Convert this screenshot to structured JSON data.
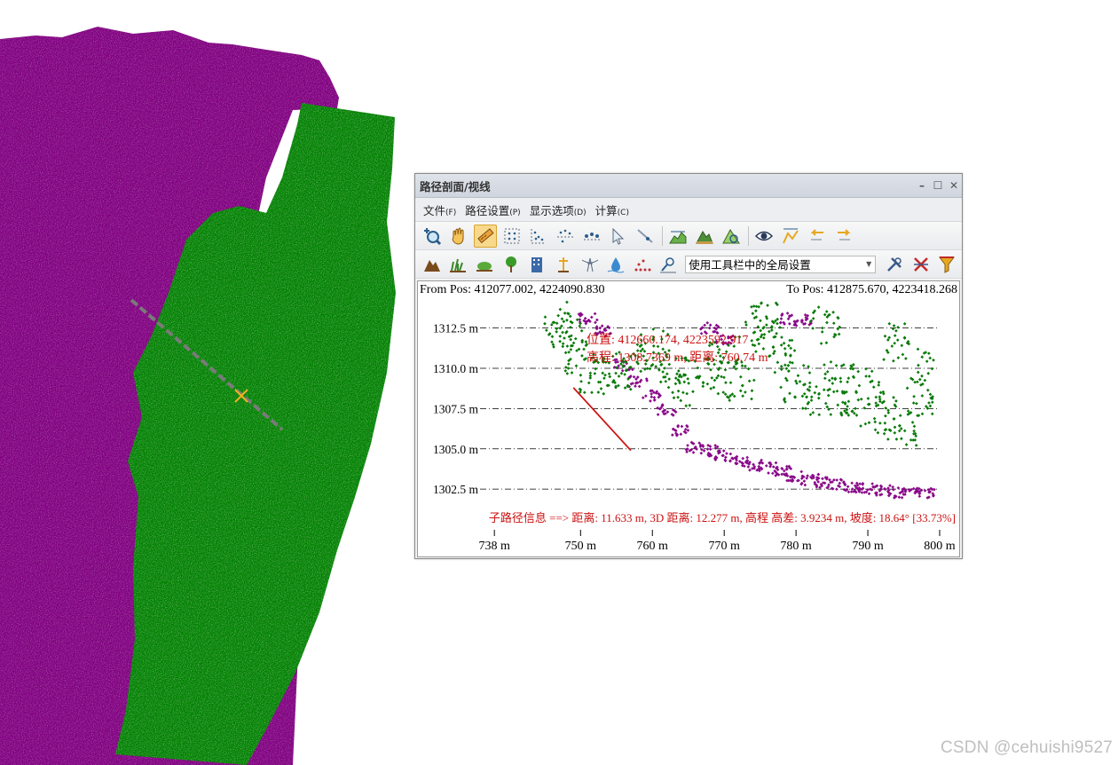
{
  "watermark": "CSDN @cehuishi9527",
  "window": {
    "title": "路径剖面/视线",
    "controls": {
      "minimize": "–",
      "maximize": "☐",
      "close": "✕"
    }
  },
  "menu": [
    {
      "label": "文件",
      "accel": "(F)"
    },
    {
      "label": "路径设置",
      "accel": "(P)"
    },
    {
      "label": "显示选项",
      "accel": "(D)"
    },
    {
      "label": "计算",
      "accel": "(C)"
    }
  ],
  "toolbar1_icons": [
    "zoom-in-icon",
    "pan-hand-icon",
    "measure-ruler-icon",
    "grid-points-icon",
    "scatter-points-icon",
    "point-line-icon",
    "profile-points-icon",
    "select-arrow-icon",
    "line-select-icon",
    "terrain-profile-icon",
    "mountain-profile-icon",
    "area-profile-icon",
    "visibility-eye-icon",
    "line-of-sight-icon",
    "step-back-icon",
    "step-forward-icon"
  ],
  "toolbar2_icons": [
    "ground-icon",
    "vegetation-low-icon",
    "shrub-icon",
    "tree-icon",
    "building-icon",
    "pole-icon",
    "powerline-icon",
    "water-icon",
    "dotted-line-icon",
    "pen-select-icon"
  ],
  "toolbar2_tail_icons": [
    "settings-tools-icon",
    "clear-icon",
    "filter-icon"
  ],
  "toolbar_combo": {
    "value": "使用工具栏中的全局设置",
    "arrow_icon": "chevron-down-icon"
  },
  "profile": {
    "from_label": "From Pos: 412077.002, 4224090.830",
    "to_label": "To Pos: 412875.670, 4223418.268",
    "cursor_info_1": "位置: 412660.174, 4223592.917",
    "cursor_info_2": "高程: 1308.7369 m, 距离: 760.74 m",
    "subpath_info": "子路径信息 ==> 距离: 11.633 m, 3D 距离: 12.277 m, 高程 高差: 3.9234 m, 坡度: 18.64° [33.73%]",
    "colors": {
      "ground": "#8a0a8a",
      "vegetation": "#0a7a0a",
      "annotation": "#cc1111"
    }
  },
  "chart_data": {
    "type": "scatter",
    "x_axis": {
      "unit": "m",
      "range": [
        736,
        800
      ],
      "ticks": [
        738,
        750,
        760,
        770,
        780,
        790,
        800
      ],
      "tick_labels": [
        "738 m",
        "750 m",
        "760 m",
        "770 m",
        "780 m",
        "790 m",
        "800 m"
      ]
    },
    "y_axis": {
      "unit": "m",
      "range": [
        1301.9,
        1314.3
      ],
      "ticks": [
        1302.5,
        1305.0,
        1307.5,
        1310.0,
        1312.5
      ],
      "tick_labels": [
        "1302.5 m",
        "1305.0 m",
        "1307.5 m",
        "1310.0 m",
        "1312.5 m"
      ]
    },
    "grid": "horizontal dash-dot",
    "series": [
      {
        "class": "ground",
        "color": "#8a0a8a",
        "points": [
          [
            751,
            1313.1
          ],
          [
            753,
            1312.3
          ],
          [
            756,
            1310.2
          ],
          [
            758,
            1309.2
          ],
          [
            760,
            1308.3
          ],
          [
            762,
            1307.4
          ],
          [
            764,
            1306.1
          ],
          [
            766,
            1305.1
          ],
          [
            768,
            1304.9
          ],
          [
            770,
            1304.6
          ],
          [
            772,
            1304.3
          ],
          [
            774,
            1304.0
          ],
          [
            776,
            1303.8
          ],
          [
            778,
            1303.6
          ],
          [
            780,
            1303.3
          ],
          [
            782,
            1303.1
          ],
          [
            784,
            1302.9
          ],
          [
            786,
            1302.8
          ],
          [
            788,
            1302.6
          ],
          [
            790,
            1302.5
          ],
          [
            792,
            1302.4
          ],
          [
            794,
            1302.3
          ],
          [
            796,
            1302.2
          ],
          [
            798,
            1302.2
          ],
          [
            768,
            1312.5
          ],
          [
            770,
            1311.8
          ],
          [
            779,
            1313.1
          ],
          [
            781,
            1313.0
          ]
        ]
      },
      {
        "class": "vegetation",
        "color": "#0a7a0a",
        "points": [
          [
            747,
            1313.2
          ],
          [
            748,
            1312.0
          ],
          [
            750,
            1310.6
          ],
          [
            752,
            1309.6
          ],
          [
            755,
            1309.8
          ],
          [
            758,
            1310.4
          ],
          [
            760,
            1311.3
          ],
          [
            763,
            1310.0
          ],
          [
            765,
            1308.6
          ],
          [
            768,
            1309.5
          ],
          [
            770,
            1310.8
          ],
          [
            772,
            1309.2
          ],
          [
            775,
            1312.1
          ],
          [
            778,
            1310.9
          ],
          [
            780,
            1309.0
          ],
          [
            783,
            1308.3
          ],
          [
            786,
            1309.4
          ],
          [
            788,
            1307.6
          ],
          [
            790,
            1308.9
          ],
          [
            793,
            1307.1
          ],
          [
            795,
            1306.4
          ],
          [
            797,
            1308.2
          ],
          [
            799,
            1310.1
          ],
          [
            794,
            1311.6
          ],
          [
            776,
            1313.0
          ],
          [
            784,
            1312.6
          ]
        ]
      }
    ],
    "annotation": {
      "type": "segment",
      "from": [
        749,
        1308.8
      ],
      "to": [
        757,
        1304.9
      ],
      "color": "#cc1111"
    }
  }
}
